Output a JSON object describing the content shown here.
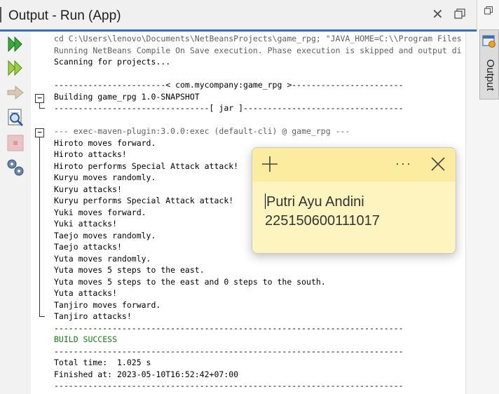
{
  "window": {
    "title": "Output - Run (App)"
  },
  "side_tab": {
    "label": "Output"
  },
  "toolbar": {
    "icons": [
      "rerun-icon",
      "rerun-with-options-icon",
      "stop-arrow-icon",
      "find-icon",
      "stop-icon",
      "settings-icon"
    ]
  },
  "console": {
    "lines": [
      {
        "text": "cd C:\\Users\\lenovo\\Documents\\NetBeansProjects\\game_rpg; \"JAVA_HOME=C:\\\\Program Files",
        "style": "dim"
      },
      {
        "text": "Running NetBeans Compile On Save execution. Phase execution is skipped and output di",
        "style": "dim"
      },
      {
        "text": "Scanning for projects...",
        "style": ""
      },
      {
        "text": "",
        "style": ""
      },
      {
        "text": "-----------------------< com.mycompany:game_rpg >-----------------------",
        "style": ""
      },
      {
        "text": "Building game_rpg 1.0-SNAPSHOT",
        "style": ""
      },
      {
        "text": "--------------------------------[ jar ]---------------------------------",
        "style": ""
      },
      {
        "text": "",
        "style": ""
      },
      {
        "text": "--- exec-maven-plugin:3.0.0:exec (default-cli) @ game_rpg ---",
        "style": "dim"
      },
      {
        "text": "Hiroto moves forward.",
        "style": ""
      },
      {
        "text": "Hiroto attacks!",
        "style": ""
      },
      {
        "text": "Hiroto performs Special Attack attack!",
        "style": ""
      },
      {
        "text": "Kuryu moves randomly.",
        "style": ""
      },
      {
        "text": "Kuryu attacks!",
        "style": ""
      },
      {
        "text": "Kuryu performs Special Attack attack!",
        "style": ""
      },
      {
        "text": "Yuki moves forward.",
        "style": ""
      },
      {
        "text": "Yuki attacks!",
        "style": ""
      },
      {
        "text": "Taejo moves randomly.",
        "style": ""
      },
      {
        "text": "Taejo attacks!",
        "style": ""
      },
      {
        "text": "Yuta moves randomly.",
        "style": ""
      },
      {
        "text": "Yuta moves 5 steps to the east.",
        "style": ""
      },
      {
        "text": "Yuta moves 5 steps to the east and 0 steps to the south.",
        "style": ""
      },
      {
        "text": "Yuta attacks!",
        "style": ""
      },
      {
        "text": "Tanjiro moves forward.",
        "style": ""
      },
      {
        "text": "Tanjiro attacks!",
        "style": ""
      },
      {
        "text": "------------------------------------------------------------------------",
        "style": ""
      },
      {
        "text": "BUILD SUCCESS",
        "style": "success"
      },
      {
        "text": "------------------------------------------------------------------------",
        "style": ""
      },
      {
        "text": "Total time:  1.025 s",
        "style": ""
      },
      {
        "text": "Finished at: 2023-05-10T16:52:42+07:00",
        "style": ""
      },
      {
        "text": "------------------------------------------------------------------------",
        "style": ""
      }
    ]
  },
  "sticky_note": {
    "line1": "Putri Ayu Andini",
    "line2": "225150600111017",
    "more_label": "···"
  },
  "colors": {
    "accent": "#3b6cc4",
    "success": "#1a7a1a",
    "note_bg": "#fdf4bf",
    "note_header": "#fbeca0"
  }
}
